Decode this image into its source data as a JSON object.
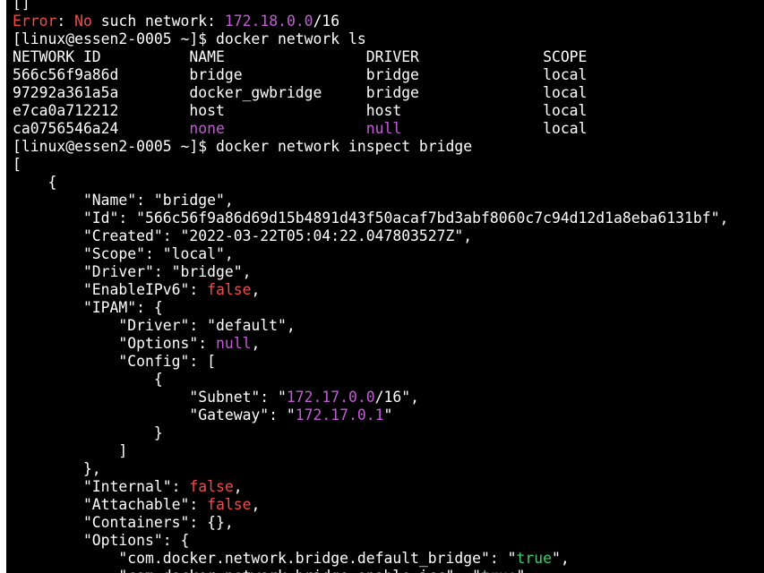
{
  "terminal": {
    "colors": {
      "background": "#000000",
      "text": "#ffffff",
      "red": "#f14c4c",
      "magenta": "#c45bd6",
      "green": "#3ccf6a"
    },
    "lines": [
      [
        {
          "t": "[]"
        }
      ],
      [
        {
          "t": "Error",
          "c": "red"
        },
        {
          "t": ": "
        },
        {
          "t": "No",
          "c": "red"
        },
        {
          "t": " such network: "
        },
        {
          "t": "172.18.0.0",
          "c": "mag"
        },
        {
          "t": "/16"
        }
      ],
      [
        {
          "t": "[linux@essen2-0005 ~]$ docker network ls"
        }
      ],
      [
        {
          "t": "NETWORK ID          NAME                DRIVER              SCOPE"
        }
      ],
      [
        {
          "t": "566c56f9a86d        bridge              bridge              local"
        }
      ],
      [
        {
          "t": "97292a361a5a        docker_gwbridge     bridge              local"
        }
      ],
      [
        {
          "t": "e7ca0a712212        host                host                local"
        }
      ],
      [
        {
          "t": "ca0756546a24        "
        },
        {
          "t": "none",
          "c": "mag"
        },
        {
          "t": "                "
        },
        {
          "t": "null",
          "c": "mag"
        },
        {
          "t": "                local"
        }
      ],
      [
        {
          "t": "[linux@essen2-0005 ~]$ docker network inspect bridge"
        }
      ],
      [
        {
          "t": "["
        }
      ],
      [
        {
          "t": "    {"
        }
      ],
      [
        {
          "t": "        \"Name\": \"bridge\","
        }
      ],
      [
        {
          "t": "        \"Id\": \"566c56f9a86d69d15b4891d43f50acaf7bd3abf8060c7c94d12d1a8eba6131bf\","
        }
      ],
      [
        {
          "t": "        \"Created\": \"2022-03-22T05:04:22.047803527Z\","
        }
      ],
      [
        {
          "t": "        \"Scope\": \"local\","
        }
      ],
      [
        {
          "t": "        \"Driver\": \"bridge\","
        }
      ],
      [
        {
          "t": "        \"EnableIPv6\": "
        },
        {
          "t": "false",
          "c": "red"
        },
        {
          "t": ","
        }
      ],
      [
        {
          "t": "        \"IPAM\": {"
        }
      ],
      [
        {
          "t": "            \"Driver\": \"default\","
        }
      ],
      [
        {
          "t": "            \"Options\": "
        },
        {
          "t": "null",
          "c": "mag"
        },
        {
          "t": ","
        }
      ],
      [
        {
          "t": "            \"Config\": ["
        }
      ],
      [
        {
          "t": "                {"
        }
      ],
      [
        {
          "t": "                    \"Subnet\": \""
        },
        {
          "t": "172.17.0.0",
          "c": "mag"
        },
        {
          "t": "/16\","
        }
      ],
      [
        {
          "t": "                    \"Gateway\": \""
        },
        {
          "t": "172.17.0.1",
          "c": "mag"
        },
        {
          "t": "\""
        }
      ],
      [
        {
          "t": "                }"
        }
      ],
      [
        {
          "t": "            ]"
        }
      ],
      [
        {
          "t": "        },"
        }
      ],
      [
        {
          "t": "        \"Internal\": "
        },
        {
          "t": "false",
          "c": "red"
        },
        {
          "t": ","
        }
      ],
      [
        {
          "t": "        \"Attachable\": "
        },
        {
          "t": "false",
          "c": "red"
        },
        {
          "t": ","
        }
      ],
      [
        {
          "t": "        \"Containers\": {},"
        }
      ],
      [
        {
          "t": "        \"Options\": {"
        }
      ],
      [
        {
          "t": "            \"com.docker.network.bridge.default_bridge\": \""
        },
        {
          "t": "true",
          "c": "green"
        },
        {
          "t": "\","
        }
      ],
      [
        {
          "t": "            \"com.docker.network.bridge.enable_icc\": \""
        },
        {
          "t": "true",
          "c": "green"
        },
        {
          "t": "\","
        }
      ]
    ]
  }
}
